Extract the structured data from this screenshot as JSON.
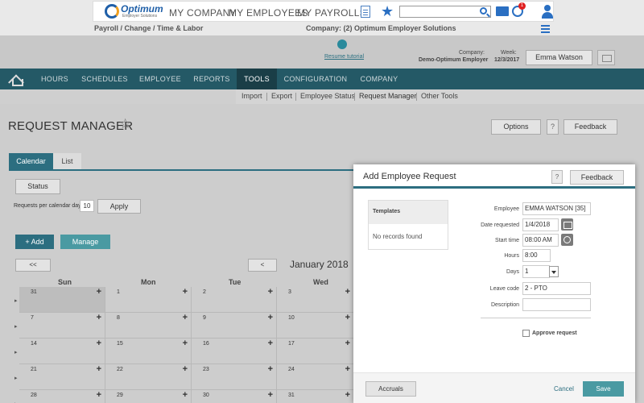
{
  "topnav": {
    "logo_name": "Optimum",
    "logo_sub": "Employer Solutions",
    "links": [
      "MY COMPANY",
      "MY EMPLOYEES",
      "MY PAYROLLS"
    ],
    "search_value": "",
    "badge_count": "1"
  },
  "subbar": {
    "breadcrumb": "Payroll / Change / Time & Labor",
    "company": "Company: (2) Optimum Employer Solutions"
  },
  "info": {
    "resume_tutorial": "Resume tutorial",
    "company_label": "Company:",
    "company_value": "Demo-Optimum Employer",
    "week_label": "Week:",
    "week_value": "12/3/2017",
    "user_name": "Emma Watson"
  },
  "mainnav": {
    "items": [
      "HOURS",
      "SCHEDULES",
      "EMPLOYEE",
      "REPORTS",
      "TOOLS",
      "CONFIGURATION",
      "COMPANY"
    ],
    "active": "TOOLS"
  },
  "tools_sub": {
    "items": [
      "Import",
      "Export",
      "Employee Status",
      "Request Manager",
      "Other Tools"
    ]
  },
  "page": {
    "title": "REQUEST MANAGER",
    "options": "Options",
    "help": "?",
    "feedback": "Feedback",
    "tabs": [
      "Calendar",
      "List"
    ],
    "status": "Status",
    "rpd_label": "Requests per calendar day",
    "rpd_value": "10",
    "apply": "Apply",
    "add": "Add",
    "manage": "Manage",
    "prev": "<<",
    "prev2": "<",
    "month": "January 2018"
  },
  "calendar": {
    "dow": [
      "Sun",
      "Mon",
      "Tue",
      "Wed"
    ],
    "weeks": [
      [
        "31",
        "1",
        "2",
        "3"
      ],
      [
        "7",
        "8",
        "9",
        "10"
      ],
      [
        "14",
        "15",
        "16",
        "17"
      ],
      [
        "21",
        "22",
        "23",
        "24"
      ],
      [
        "28",
        "29",
        "30",
        "31"
      ]
    ]
  },
  "modal": {
    "title": "Add Employee Request",
    "help": "?",
    "feedback": "Feedback",
    "templates_head": "Templates",
    "templates_empty": "No records found",
    "fields": {
      "employee_label": "Employee",
      "employee_value": "EMMA WATSON [35]",
      "date_label": "Date requested",
      "date_value": "1/4/2018",
      "start_label": "Start time",
      "start_value": "08:00 AM",
      "hours_label": "Hours",
      "hours_value": "8:00",
      "days_label": "Days",
      "days_value": "1",
      "leave_label": "Leave code",
      "leave_value": "2 - PTO",
      "desc_label": "Description",
      "desc_value": ""
    },
    "approve": "Approve request",
    "accruals": "Accruals",
    "cancel": "Cancel",
    "save": "Save"
  }
}
